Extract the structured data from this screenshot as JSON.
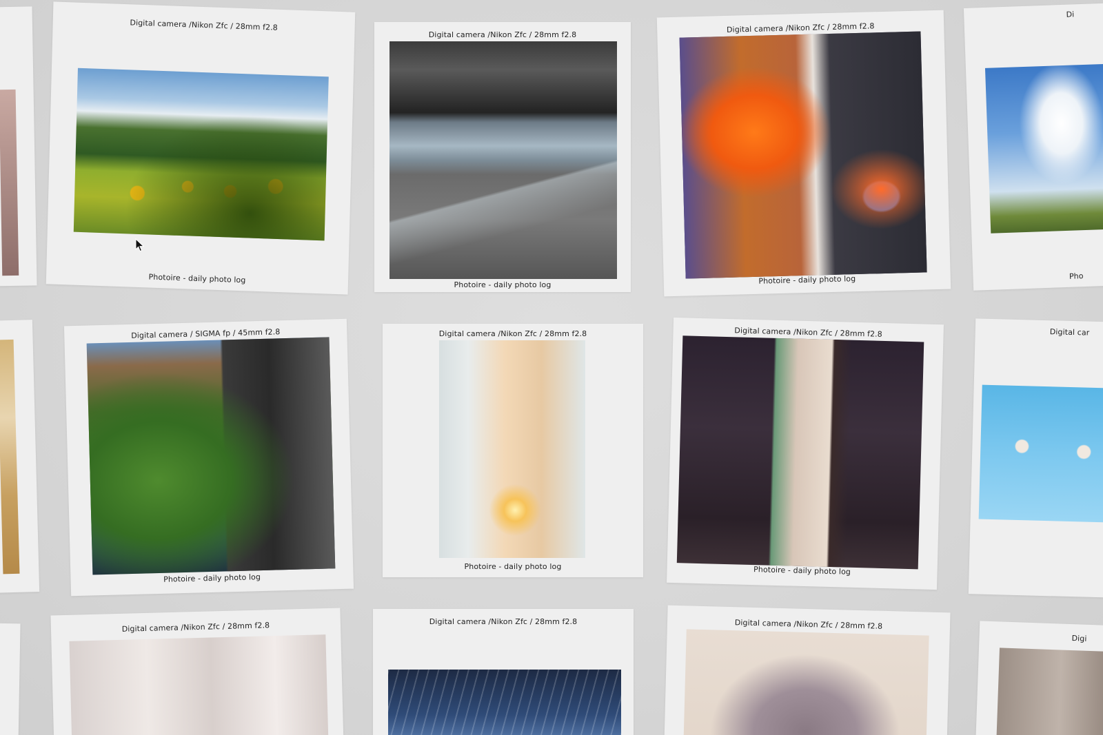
{
  "gallery": {
    "caption_footer": "Photoire - daily photo log",
    "cards": [
      {
        "id": "r0c0",
        "top_caption": "",
        "bottom_caption": "",
        "photo": "portrait-edge"
      },
      {
        "id": "r0c1",
        "top_caption": "Digital camera /Nikon Zfc / 28mm f2.8",
        "bottom_caption": "Photoire - daily photo log",
        "photo": "sunflower-field"
      },
      {
        "id": "r0c2",
        "top_caption": "Digital camera /Nikon Zfc / 28mm f2.8",
        "bottom_caption": "Photoire - daily photo log",
        "photo": "concrete-atrium"
      },
      {
        "id": "r0c3",
        "top_caption": "Digital camera /Nikon Zfc / 28mm f2.8",
        "bottom_caption": "Photoire - daily photo log",
        "photo": "projection-mapping-building"
      },
      {
        "id": "r0c4",
        "top_caption": "Di",
        "bottom_caption": "Pho",
        "photo": "blue-sky-clouds"
      },
      {
        "id": "r1c0",
        "top_caption": "",
        "bottom_caption": "",
        "photo": "noodle-dish-edge"
      },
      {
        "id": "r1c1",
        "top_caption": "Digital camera / SIGMA fp / 45mm f2.8",
        "bottom_caption": "Photoire - daily photo log",
        "photo": "garden-shopping-street"
      },
      {
        "id": "r1c2",
        "top_caption": "Digital camera /Nikon Zfc / 28mm f2.8",
        "bottom_caption": "Photoire - daily photo log",
        "photo": "bird-lamp"
      },
      {
        "id": "r1c3",
        "top_caption": "Digital camera /Nikon Zfc / 28mm f2.8",
        "bottom_caption": "Photoire - daily photo log",
        "photo": "japanese-room-window"
      },
      {
        "id": "r1c4",
        "top_caption": "Digital car",
        "bottom_caption": "",
        "photo": "lanterns-sky"
      },
      {
        "id": "r2c0",
        "top_caption": "",
        "bottom_caption": "",
        "photo": "edge"
      },
      {
        "id": "r2c1",
        "top_caption": "Digital camera /Nikon Zfc / 28mm f2.8",
        "bottom_caption": "",
        "photo": "curtain-light"
      },
      {
        "id": "r2c2",
        "top_caption": "Digital camera /Nikon Zfc / 28mm f2.8",
        "bottom_caption": "",
        "photo": "steel-roof-sky"
      },
      {
        "id": "r2c3",
        "top_caption": "Digital camera /Nikon Zfc / 28mm f2.8",
        "bottom_caption": "",
        "photo": "knit-bag"
      },
      {
        "id": "r2c4",
        "top_caption": "Digi",
        "bottom_caption": "",
        "photo": "blurred"
      }
    ]
  },
  "colors": {
    "background": "#d9d9d9",
    "card": "#efefef",
    "caption_text": "#222222"
  },
  "icons": {
    "cursor": "mouse-pointer-icon"
  }
}
